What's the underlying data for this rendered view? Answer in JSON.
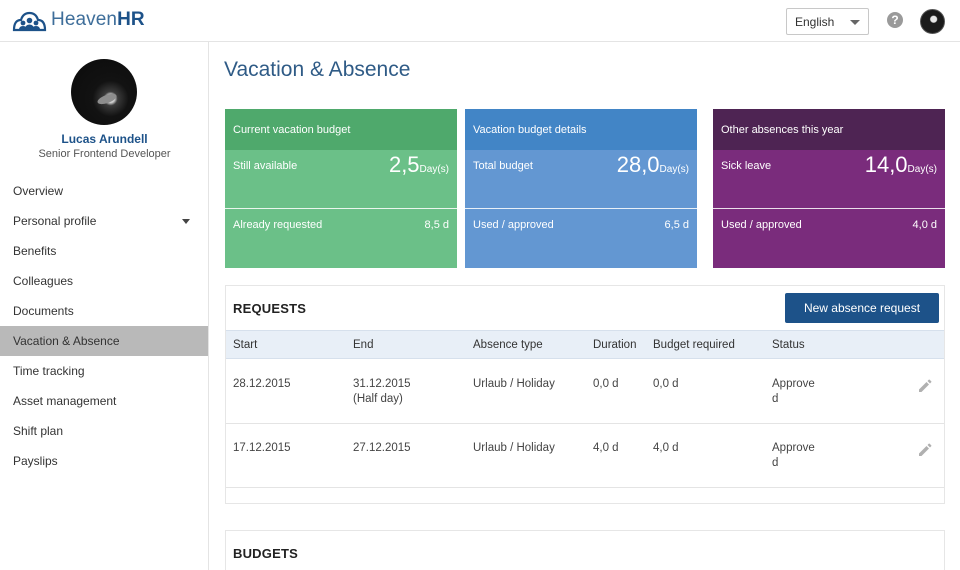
{
  "app": {
    "brand_light": "Heaven",
    "brand_bold": "HR",
    "brand_color": "#1d5289"
  },
  "header": {
    "language": "English",
    "help_icon": "question-icon",
    "help_glyph": "?"
  },
  "profile": {
    "name": "Lucas Arundell",
    "role": "Senior Frontend Developer"
  },
  "sidebar": {
    "items": [
      {
        "label": "Overview"
      },
      {
        "label": "Personal profile"
      },
      {
        "label": "Benefits"
      },
      {
        "label": "Colleagues"
      },
      {
        "label": "Documents"
      },
      {
        "label": "Vacation & Absence"
      },
      {
        "label": "Time tracking"
      },
      {
        "label": "Asset management"
      },
      {
        "label": "Shift plan"
      },
      {
        "label": "Payslips"
      }
    ],
    "active": "Vacation & Absence"
  },
  "page": {
    "title": "Vacation & Absence"
  },
  "cards": {
    "vacation": {
      "title": "Current vacation budget",
      "row1_label": "Still available",
      "row1_value": "2,5",
      "row1_unit": "Day(s)",
      "row2_label": "Already requested",
      "row2_value": "8,5 d",
      "color": "#4fa96c"
    },
    "details": {
      "title": "Vacation budget details",
      "row1_label": "Total budget",
      "row1_value": "28,0",
      "row1_unit": "Day(s)",
      "row2_label": "Used / approved",
      "row2_value": "6,5 d",
      "color": "#4285c6"
    },
    "other": {
      "title": "Other absences this year",
      "row1_label": "Sick leave",
      "row1_value": "14,0",
      "row1_unit": "Day(s)",
      "row2_label": "Used / approved",
      "row2_value": "4,0 d",
      "color": "#4e2453"
    }
  },
  "requests": {
    "title": "REQUESTS",
    "new_button": "New absence request",
    "columns": {
      "start": "Start",
      "end": "End",
      "type": "Absence type",
      "duration": "Duration",
      "budget": "Budget required",
      "status": "Status"
    },
    "rows": [
      {
        "start": "28.12.2015",
        "end": "31.12.2015",
        "end_note": "(Half day)",
        "type": "Urlaub / Holiday",
        "duration": "0,0 d",
        "budget": "0,0 d",
        "status": "Approved"
      },
      {
        "start": "17.12.2015",
        "end": "27.12.2015",
        "end_note": "",
        "type": "Urlaub / Holiday",
        "duration": "4,0 d",
        "budget": "4,0 d",
        "status": "Approved"
      }
    ]
  },
  "budgets": {
    "title": "BUDGETS"
  }
}
